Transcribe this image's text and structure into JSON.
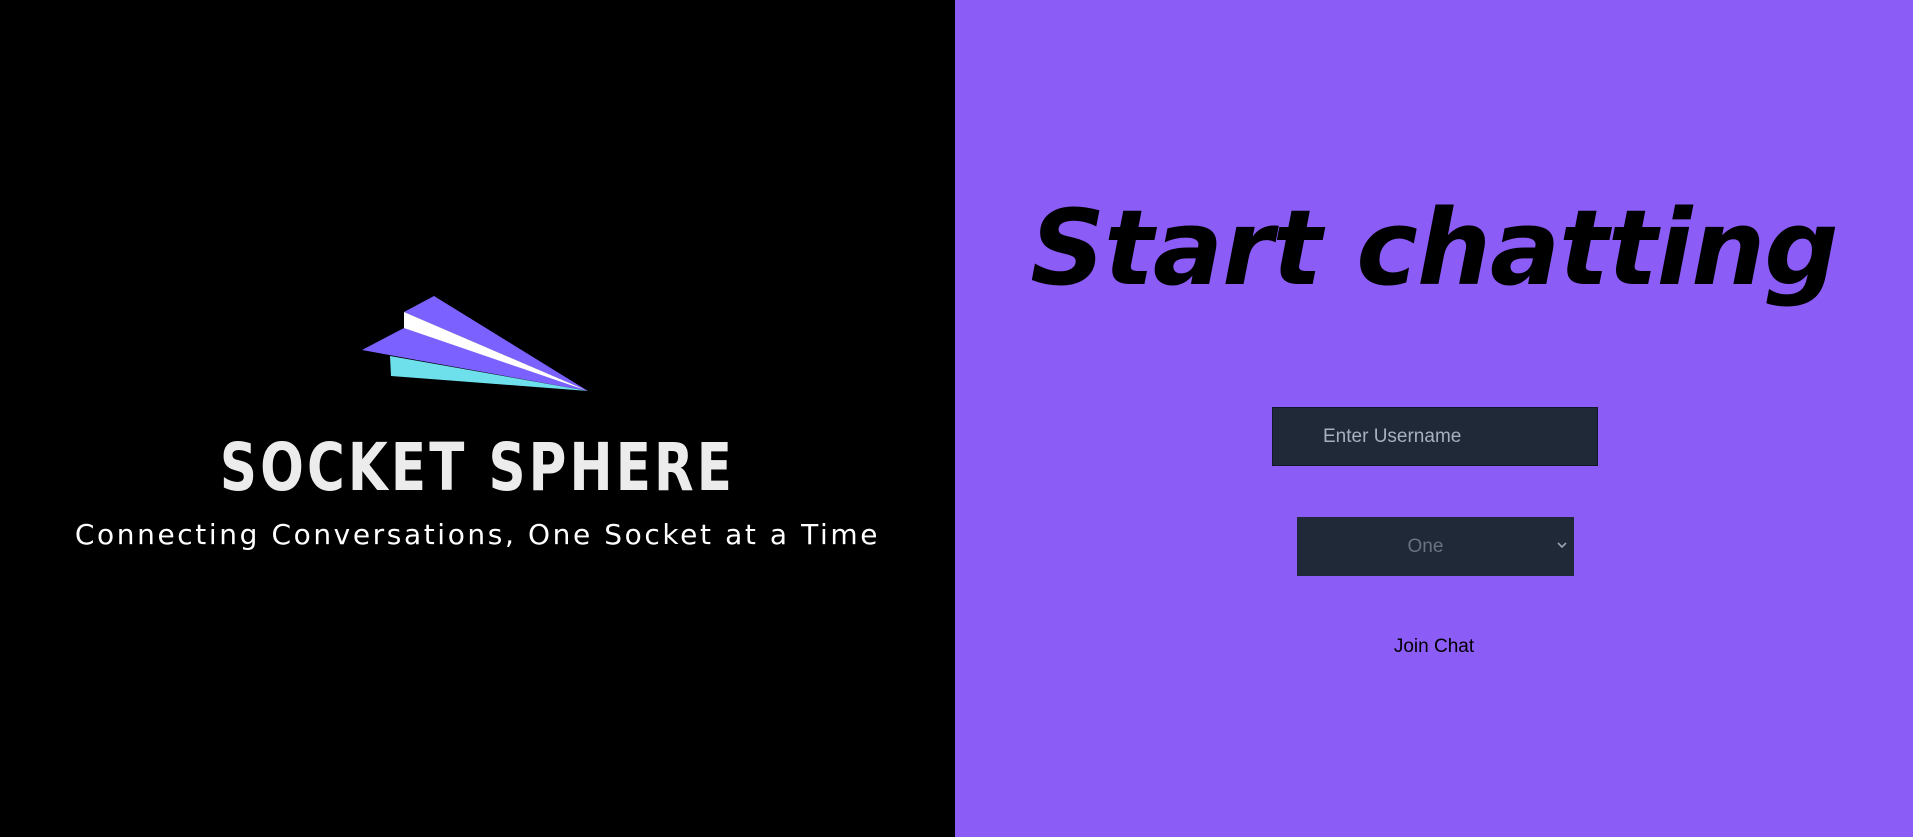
{
  "brand": {
    "name": "SOCKET SPHERE",
    "tagline": "Connecting Conversations, One Socket at a Time",
    "logo_icon": "paper-plane-icon",
    "logo_colors": [
      "#7b61ff",
      "#ffffff",
      "#6ee0ec"
    ]
  },
  "form": {
    "heading": "Start chatting",
    "username_placeholder": "Enter Username",
    "username_value": "",
    "room_selected": "One",
    "room_options": [
      "One"
    ],
    "join_label": "Join Chat"
  },
  "colors": {
    "left_background": "#000000",
    "right_background": "#8b5cf6",
    "field_background": "#1f2937"
  }
}
